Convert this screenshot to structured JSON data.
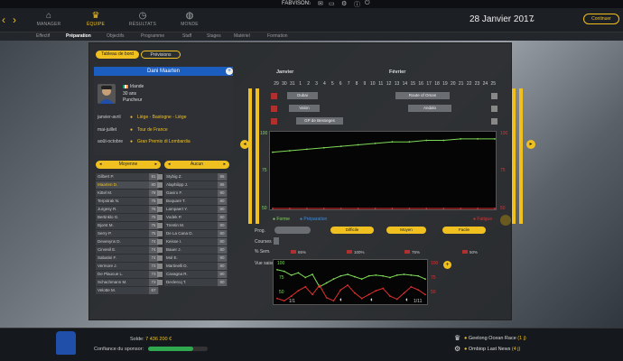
{
  "topbar": {
    "brand": "FABVISON"
  },
  "nav": {
    "items": [
      {
        "label": "MANAGER",
        "icon": "house-icon"
      },
      {
        "label": "ÉQUIPE",
        "icon": "trophy-icon"
      },
      {
        "label": "RÉSULTATS",
        "icon": "stopwatch-icon"
      },
      {
        "label": "MONDE",
        "icon": "globe-icon"
      }
    ],
    "date": "28 Janvier 2017",
    "continue": "Continuer"
  },
  "subtabs": [
    "Effectif",
    "Préparation",
    "Objectifs",
    "Programme",
    "Staff",
    "Stages",
    "Matériel",
    "Formation"
  ],
  "view_tabs": {
    "dashboard": "Tableau de bord",
    "previsions": "Prévisions"
  },
  "rider": {
    "name": "Dani Maarten",
    "country": "Irlande",
    "age": "30 ans",
    "type": "Puncheur",
    "goals": [
      {
        "period": "janvier-avril",
        "value": "Liège - Bastogne - Liège"
      },
      {
        "period": "mai-juillet",
        "value": "Tour de France"
      },
      {
        "period": "août-octobre",
        "value": "Gran Premio di Lombardia"
      }
    ]
  },
  "filters": {
    "left": "Moyenne",
    "right": "Aucun"
  },
  "roster_left": [
    {
      "name": "Gilbert P.",
      "score": "81"
    },
    {
      "name": "Maarten D.",
      "score": "80"
    },
    {
      "name": "Kittel M.",
      "score": "78"
    },
    {
      "name": "Terpstrak N.",
      "score": "76"
    },
    {
      "name": "Jurgesy R.",
      "score": "76"
    },
    {
      "name": "Bertinklo G.",
      "score": "75"
    },
    {
      "name": "Bjorst M.",
      "score": "75"
    },
    {
      "name": "Serry P.",
      "score": "75"
    },
    {
      "name": "Devenyns D.",
      "score": "74"
    },
    {
      "name": "Cirvenil E.",
      "score": "74"
    },
    {
      "name": "Sabatini F.",
      "score": "74"
    },
    {
      "name": "Vermore J.",
      "score": "73"
    },
    {
      "name": "De Plaucue L.",
      "score": "73"
    },
    {
      "name": "Schachmann M.",
      "score": "73"
    },
    {
      "name": "Velotte M.",
      "score": "67"
    }
  ],
  "roster_right": [
    {
      "name": "Stybig Z.",
      "score": "86"
    },
    {
      "name": "Alaphilipp J.",
      "score": "86"
    },
    {
      "name": "Gaviro F.",
      "score": "80"
    },
    {
      "name": "Boquare T.",
      "score": "80"
    },
    {
      "name": "Lampaert Y.",
      "score": "80"
    },
    {
      "name": "Vodek P.",
      "score": "80"
    },
    {
      "name": "Trentin M.",
      "score": "80"
    },
    {
      "name": "De La Cana D.",
      "score": "80"
    },
    {
      "name": "Keisse I.",
      "score": "80"
    },
    {
      "name": "Bauer J.",
      "score": "80"
    },
    {
      "name": "Mol E.",
      "score": "80"
    },
    {
      "name": "Martinelli D.",
      "score": "80"
    },
    {
      "name": "Cavagna R.",
      "score": "80"
    },
    {
      "name": "Declercq T.",
      "score": "80"
    }
  ],
  "calendar": {
    "months": [
      "Janvier",
      "Février"
    ],
    "days": [
      "29",
      "30",
      "31",
      "1",
      "2",
      "3",
      "4",
      "5",
      "6",
      "7",
      "8",
      "9",
      "10",
      "11",
      "12",
      "13",
      "14",
      "15",
      "16",
      "17",
      "18",
      "19",
      "20",
      "21",
      "22",
      "23",
      "24",
      "25"
    ],
    "races": [
      "Dubai",
      "Route of Oman",
      "Valon",
      "Andalo",
      "GP de Besseges"
    ]
  },
  "chart_data": [
    {
      "type": "line",
      "title": "",
      "ylim": [
        50,
        100
      ],
      "y_ticks_left": [
        "100",
        "75",
        "50"
      ],
      "y_ticks_right": [
        "100",
        "75",
        "50"
      ],
      "series": [
        {
          "name": "Forme",
          "color": "#7ed957",
          "values": [
            88,
            89,
            90,
            91,
            92,
            93,
            94,
            95,
            95,
            96,
            96,
            97,
            97,
            97
          ]
        },
        {
          "name": "Préparation",
          "color": "#3c8ce0",
          "values": [
            50,
            50,
            50,
            50,
            50,
            50,
            50,
            50,
            50,
            50,
            50,
            50,
            50,
            50
          ]
        },
        {
          "name": "Fatigue",
          "color": "#e03030",
          "values": [
            50,
            50,
            50,
            50,
            50,
            50,
            50,
            50,
            50,
            50,
            50,
            50,
            50,
            50
          ]
        }
      ]
    },
    {
      "type": "line",
      "title": "Vue saison",
      "ylim": [
        50,
        100
      ],
      "y_ticks_left": [
        "100",
        "75",
        "50"
      ],
      "y_ticks_right": [
        "100",
        "75",
        "50"
      ],
      "x_labels": [
        "1/1",
        "1/11"
      ],
      "series": [
        {
          "name": "Forme",
          "color": "#7ed957",
          "values": [
            92,
            90,
            85,
            88,
            82,
            86,
            70,
            75,
            80,
            84,
            86,
            83,
            80,
            84,
            85,
            84,
            82,
            85,
            86,
            85,
            84,
            80
          ]
        },
        {
          "name": "Fatigue",
          "color": "#e03030",
          "values": [
            55,
            52,
            58,
            65,
            70,
            60,
            72,
            56,
            52,
            66,
            72,
            62,
            55,
            60,
            65,
            68,
            58,
            54,
            62,
            70,
            66,
            60
          ]
        }
      ]
    }
  ],
  "legend": {
    "forme": "Forme",
    "preparation": "Préparation",
    "fatigue": "Fatigue"
  },
  "controls": {
    "prog_label": "Prog.",
    "courses_label": "Courses",
    "sem_label": "% Sem.",
    "season_label": "Vue saison",
    "prog_items": [
      "Difficile",
      "Moyen",
      "Facile"
    ],
    "percentages": [
      "65%",
      "100%",
      "75%",
      "50%"
    ]
  },
  "footer": {
    "solde_label": "Solde:",
    "solde_value": "7 436 200 €",
    "confiance_label": "Confiance du sponsor:",
    "confiance_level": 0.75,
    "news": [
      {
        "text": "Geelong Ocean Race",
        "days": "(1 j)"
      },
      {
        "text": "Ombiop Last News",
        "days": "(4 j)"
      }
    ]
  }
}
